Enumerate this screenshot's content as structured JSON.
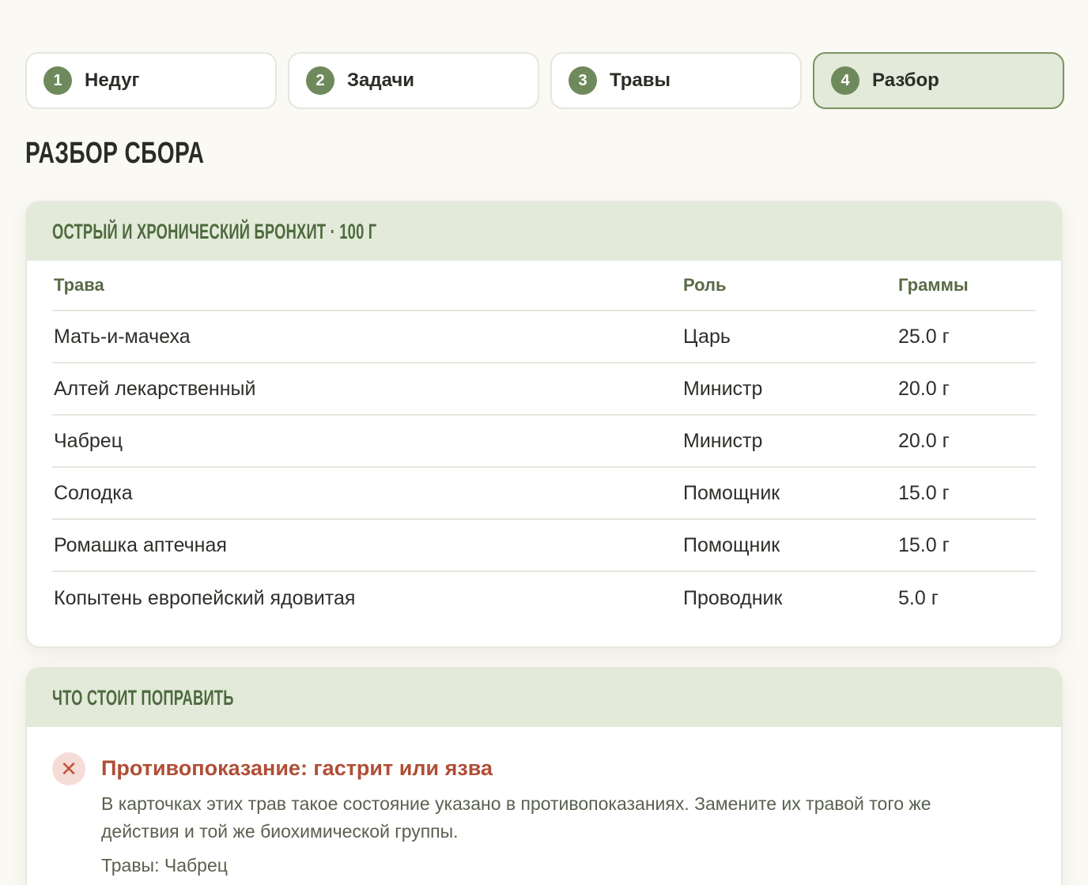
{
  "steps": [
    {
      "num": "1",
      "label": "Недуг",
      "active": false
    },
    {
      "num": "2",
      "label": "Задачи",
      "active": false
    },
    {
      "num": "3",
      "label": "Травы",
      "active": false
    },
    {
      "num": "4",
      "label": "Разбор",
      "active": true
    }
  ],
  "page_title": "Разбор сбора",
  "formula_card": {
    "title": "Острый и хронический бронхит · 100 г",
    "columns": {
      "herb": "Трава",
      "role": "Роль",
      "grams": "Граммы"
    },
    "rows": [
      {
        "herb": "Мать-и-мачеха",
        "role": "Царь",
        "grams": "25.0 г"
      },
      {
        "herb": "Алтей лекарственный",
        "role": "Министр",
        "grams": "20.0 г"
      },
      {
        "herb": "Чабрец",
        "role": "Министр",
        "grams": "20.0 г"
      },
      {
        "herb": "Солодка",
        "role": "Помощник",
        "grams": "15.0 г"
      },
      {
        "herb": "Ромашка аптечная",
        "role": "Помощник",
        "grams": "15.0 г"
      },
      {
        "herb": "Копытень европейский ядовитая",
        "role": "Проводник",
        "grams": "5.0 г"
      }
    ]
  },
  "fix_card": {
    "title": "Что стоит поправить",
    "issue": {
      "icon": "close-icon",
      "title": "Противопоказание: гастрит или язва",
      "description": "В карточках этих трав такое состояние указано в противопоказаниях. Замените их травой того же действия и той же биохимической группы.",
      "herbs": "Травы: Чабрец"
    }
  },
  "colors": {
    "accent": "#6e8a5c",
    "accent_bg": "#e3ead9",
    "warning": "#b04e36"
  }
}
